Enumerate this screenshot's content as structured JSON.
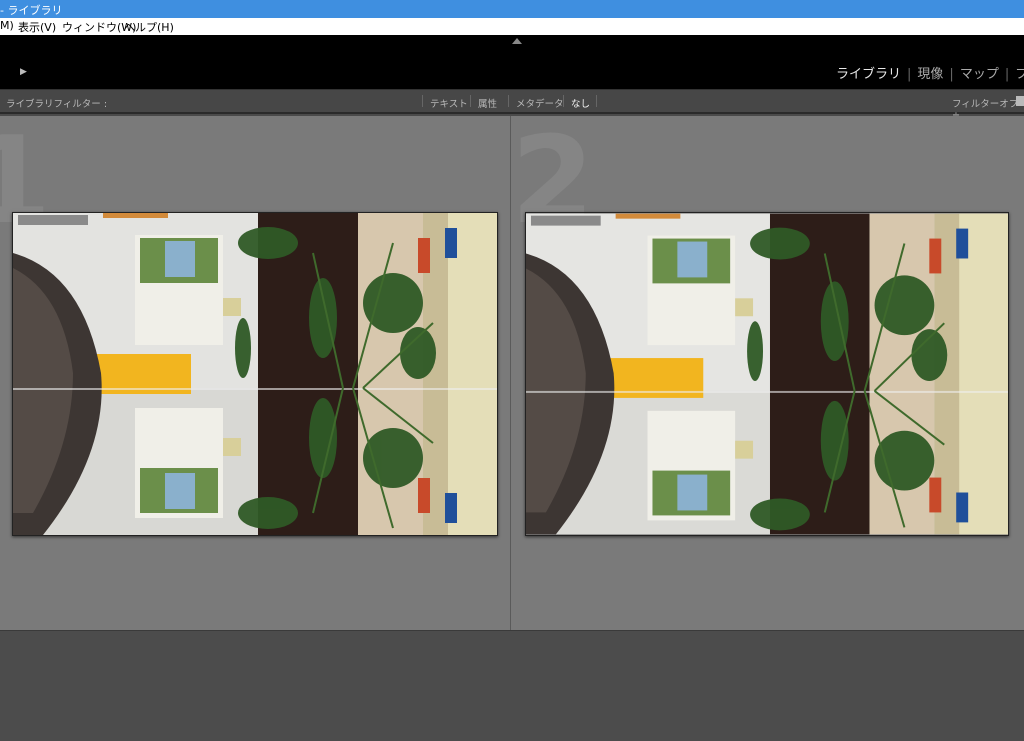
{
  "window": {
    "title": "- ライブラリ"
  },
  "menu": {
    "items": [
      "M)",
      "表示(V)",
      "ウィンドウ(W)",
      "ヘルプ(H)"
    ]
  },
  "modules": {
    "items": [
      "ライブラリ",
      "現像",
      "マップ",
      "ブ"
    ],
    "active": "ライブラリ"
  },
  "filter": {
    "label": "ライブラリフィルター :",
    "options": [
      "テキスト",
      "属性",
      "メタデータ",
      "なし"
    ],
    "selected": "なし",
    "status": "フィルターオフ ÷"
  },
  "compare": {
    "left_number": "1",
    "right_number": "2"
  },
  "colors": {
    "titlebar": "#3f8fe0",
    "header": "#000000",
    "panel": "#474747",
    "compare_bg": "#7a7a7a"
  }
}
